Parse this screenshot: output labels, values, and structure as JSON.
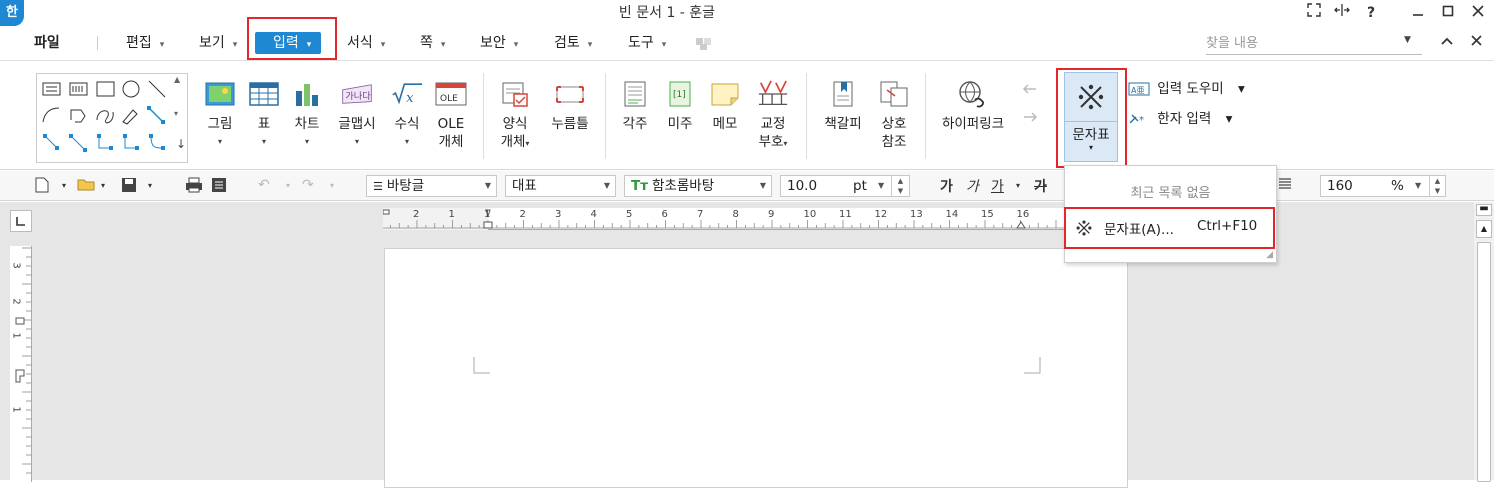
{
  "titlebar": {
    "app_icon": "한",
    "title": "빈 문서 1 - 훈글",
    "help": "?"
  },
  "menubar": {
    "items": [
      {
        "label": "파일",
        "arrow": ""
      },
      {
        "label": "편집",
        "arrow": "▾"
      },
      {
        "label": "보기",
        "arrow": "▾"
      },
      {
        "label": "입력",
        "arrow": "▾"
      },
      {
        "label": "서식",
        "arrow": "▾"
      },
      {
        "label": "쪽",
        "arrow": "▾"
      },
      {
        "label": "보안",
        "arrow": "▾"
      },
      {
        "label": "검토",
        "arrow": "▾"
      },
      {
        "label": "도구",
        "arrow": "▾"
      }
    ],
    "search_placeholder": "찾을 내용"
  },
  "ribbon": {
    "picture": "그림",
    "table": "표",
    "chart": "차트",
    "wordart": "글맵시",
    "formula": "수식",
    "ole": "OLE",
    "ole2": "개체",
    "form": "양식",
    "form2": "개체",
    "push": "누름틀",
    "footnote": "각주",
    "endnote": "미주",
    "memo": "메모",
    "proof": "교정",
    "proof2": "부호",
    "bookmark": "책갈피",
    "xref": "상호",
    "xref2": "참조",
    "hyperlink": "하이퍼링크",
    "charmap": "문자표",
    "input_helper": "입력 도우미",
    "hanja": "한자 입력",
    "dd": "▾"
  },
  "toolbar2": {
    "style": "바탕글",
    "lang": "대표",
    "font": "함초롬바탕",
    "size": "10.0",
    "unit": "pt",
    "bold": "가",
    "italic": "가",
    "underline": "가",
    "strike": "가",
    "zoom": "160",
    "zoom_unit": "%"
  },
  "popup": {
    "header": "최근 목록 없음",
    "item_label": "문자표(A)...",
    "item_shortcut": "Ctrl+F10"
  },
  "ruler": {
    "h_ticks": [
      "2",
      "1",
      "1",
      "2",
      "3",
      "4",
      "5",
      "6",
      "7",
      "8",
      "9",
      "10",
      "11",
      "12",
      "13",
      "14",
      "15",
      "16"
    ],
    "v_ticks": [
      "3",
      "2",
      "1",
      "1"
    ]
  },
  "colors": {
    "accent": "#1e88d2",
    "highlight": "#e3252c"
  }
}
